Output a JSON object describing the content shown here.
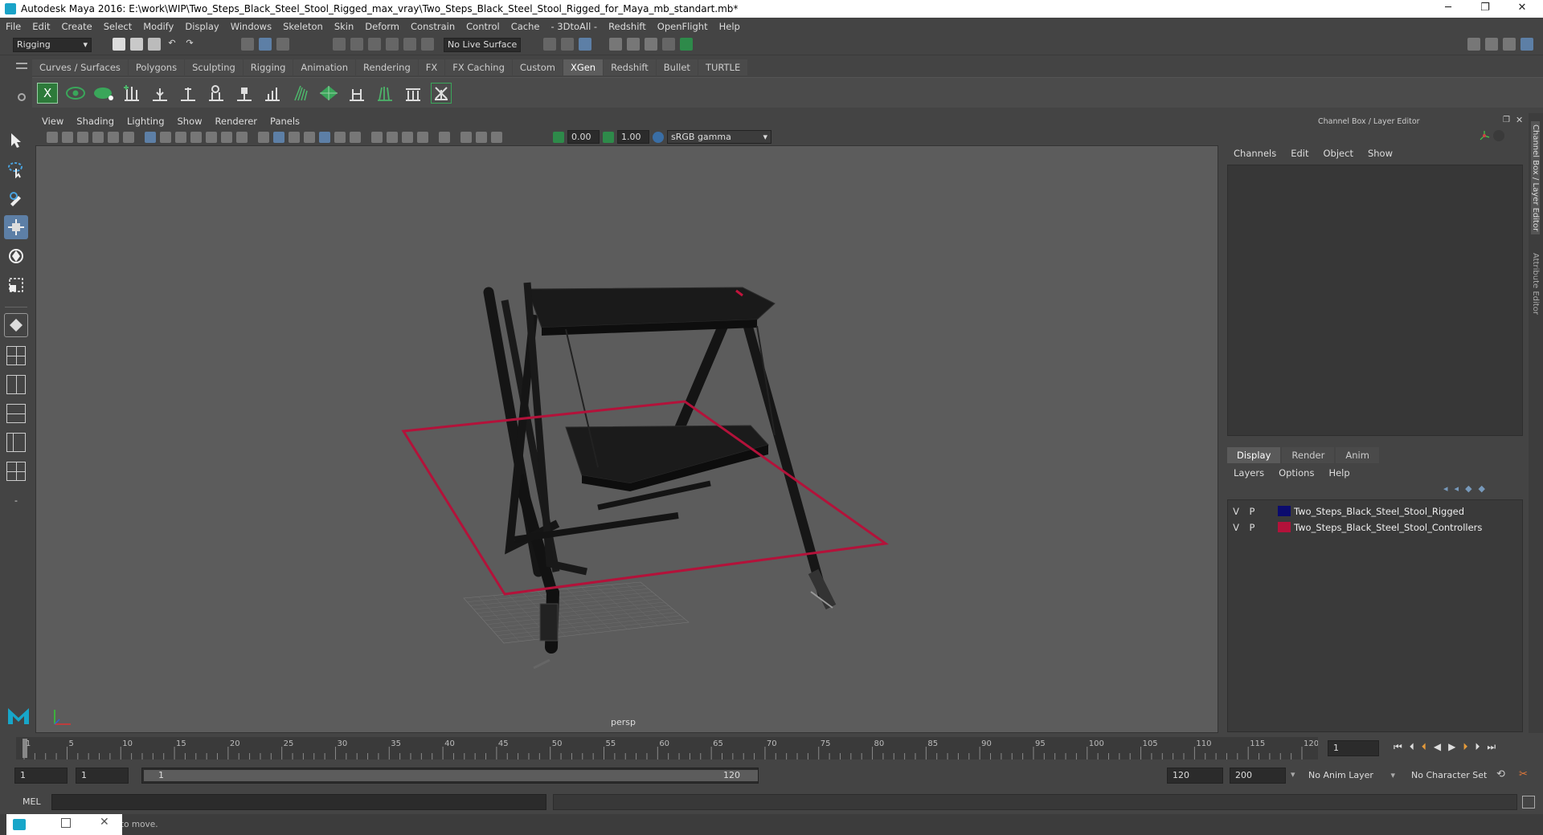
{
  "window": {
    "title": "Autodesk Maya 2016: E:\\work\\WIP\\Two_Steps_Black_Steel_Stool_Rigged_max_vray\\Two_Steps_Black_Steel_Stool_Rigged_for_Maya_mb_standart.mb*",
    "minimize": "─",
    "restore": "❐",
    "close": "✕"
  },
  "menubar": [
    "File",
    "Edit",
    "Create",
    "Select",
    "Modify",
    "Display",
    "Windows",
    "Skeleton",
    "Skin",
    "Deform",
    "Constrain",
    "Control",
    "Cache",
    "- 3DtoAll -",
    "Redshift",
    "OpenFlight",
    "Help"
  ],
  "toolbar": {
    "mode": "Rigging",
    "live_surface": "No Live Surface"
  },
  "shelf_tabs": [
    "Curves / Surfaces",
    "Polygons",
    "Sculpting",
    "Rigging",
    "Animation",
    "Rendering",
    "FX",
    "FX Caching",
    "Custom",
    "XGen",
    "Redshift",
    "Bullet",
    "TURTLE"
  ],
  "shelf_active": "XGen",
  "viewport": {
    "menu": [
      "View",
      "Shading",
      "Lighting",
      "Show",
      "Renderer",
      "Panels"
    ],
    "exposure": "0.00",
    "gamma": "1.00",
    "colorspace": "sRGB gamma",
    "camera_label": "persp"
  },
  "channel_box": {
    "title": "Channel Box / Layer Editor",
    "menu": [
      "Channels",
      "Edit",
      "Object",
      "Show"
    ]
  },
  "side_tabs": {
    "channel": "Channel Box / Layer Editor",
    "attribute": "Attribute Editor"
  },
  "layer_editor": {
    "tabs": [
      "Display",
      "Render",
      "Anim"
    ],
    "active_tab": "Display",
    "menu": [
      "Layers",
      "Options",
      "Help"
    ],
    "layers": [
      {
        "v": "V",
        "p": "P",
        "color": "#0b0b6e",
        "name": "Two_Steps_Black_Steel_Stool_Rigged"
      },
      {
        "v": "V",
        "p": "P",
        "color": "#b3123a",
        "name": "Two_Steps_Black_Steel_Stool_Controllers"
      }
    ]
  },
  "timeline": {
    "ticks": [
      "1",
      "5",
      "10",
      "15",
      "20",
      "25",
      "30",
      "35",
      "40",
      "45",
      "50",
      "55",
      "60",
      "65",
      "70",
      "75",
      "80",
      "85",
      "90",
      "95",
      "100",
      "105",
      "110",
      "115",
      "120"
    ],
    "current_frame": "1"
  },
  "range": {
    "start": "1",
    "playback_start": "1",
    "range_start_label": "1",
    "range_end_label": "120",
    "playback_end": "120",
    "end": "200",
    "anim_layer": "No Anim Layer",
    "character_set": "No Character Set"
  },
  "command_line": {
    "label": "MEL"
  },
  "status": {
    "help_text": "to move."
  },
  "colors": {
    "accent": "#5d5d5d",
    "controller_red": "#b3123a",
    "xgen_green": "#3aa65a"
  }
}
